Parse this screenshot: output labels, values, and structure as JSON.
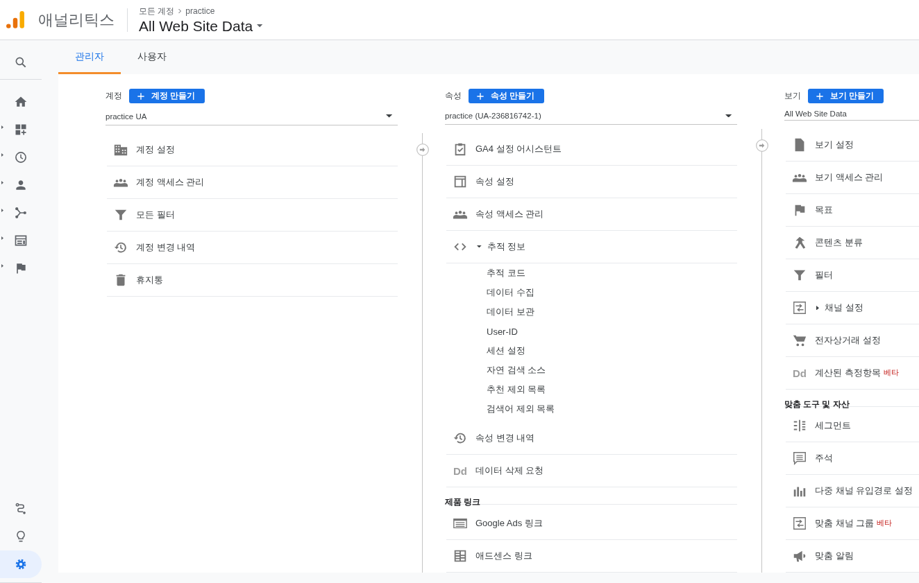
{
  "header": {
    "product": "애널리틱스",
    "breadcrumb": [
      "모든 계정",
      "practice"
    ],
    "title": "All Web Site Data"
  },
  "sidebar": {
    "items": [
      {
        "expandable": false,
        "selected": false
      },
      {
        "expandable": false,
        "selected": false
      },
      {
        "expandable": true,
        "selected": false
      },
      {
        "expandable": true,
        "selected": false
      },
      {
        "expandable": true,
        "selected": false
      },
      {
        "expandable": true,
        "selected": false
      },
      {
        "expandable": true,
        "selected": false
      },
      {
        "expandable": true,
        "selected": false
      },
      {
        "expandable": false,
        "selected": false
      },
      {
        "expandable": false,
        "selected": false
      },
      {
        "expandable": false,
        "selected": true
      }
    ]
  },
  "tabs": [
    {
      "label": "관리자",
      "selected": true
    },
    {
      "label": "사용자",
      "selected": false
    }
  ],
  "columns": [
    {
      "label": "계정",
      "button": "계정 만들기",
      "selector": {
        "value": "practice UA",
        "dropdown": true
      },
      "connector": false,
      "items": [
        {
          "kind": "item",
          "label": "계정 설정"
        },
        {
          "kind": "item",
          "label": "계정 액세스 관리"
        },
        {
          "kind": "item",
          "label": "모든 필터"
        },
        {
          "kind": "item",
          "label": "계정 변경 내역"
        },
        {
          "kind": "item",
          "label": "휴지통"
        }
      ]
    },
    {
      "label": "속성",
      "button": "속성 만들기",
      "selector": {
        "value": "practice (UA-236816742-1)",
        "dropdown": true
      },
      "connector": true,
      "items": [
        {
          "kind": "item",
          "label": "GA4 설정 어시스턴트"
        },
        {
          "kind": "item",
          "label": "속성 설정"
        },
        {
          "kind": "item",
          "label": "속성 액세스 관리"
        },
        {
          "kind": "item",
          "label": "추적 정보",
          "expanded": true,
          "children": [
            {
              "label": "추적 코드"
            },
            {
              "label": "데이터 수집"
            },
            {
              "label": "데이터 보관"
            },
            {
              "label": "User-ID"
            },
            {
              "label": "세션 설정"
            },
            {
              "label": "자연 검색 소스"
            },
            {
              "label": "추천 제외 목록"
            },
            {
              "label": "검색어 제외 목록"
            }
          ]
        },
        {
          "kind": "item",
          "label": "속성 변경 내역"
        },
        {
          "kind": "item",
          "label": "데이터 삭제 요청",
          "icon_text": "Dd"
        },
        {
          "kind": "heading",
          "label": "제품 링크"
        },
        {
          "kind": "item",
          "label": "Google Ads 링크"
        },
        {
          "kind": "item",
          "label": "애드센스 링크"
        }
      ]
    },
    {
      "label": "보기",
      "button": "보기 만들기",
      "selector": {
        "value": "All Web Site Data"
      },
      "connector": true,
      "items": [
        {
          "kind": "item",
          "label": "보기 설정"
        },
        {
          "kind": "item",
          "label": "보기 액세스 관리"
        },
        {
          "kind": "item",
          "label": "목표"
        },
        {
          "kind": "item",
          "label": "콘텐츠 분류"
        },
        {
          "kind": "item",
          "label": "필터"
        },
        {
          "kind": "item",
          "label": "채널 설정",
          "expanded": false
        },
        {
          "kind": "item",
          "label": "전자상거래 설정"
        },
        {
          "kind": "item",
          "label": "계산된 측정항목",
          "icon_text": "Dd",
          "badge": "베타"
        },
        {
          "kind": "heading",
          "label": "맞춤 도구 및 자산"
        },
        {
          "kind": "item",
          "label": "세그먼트"
        },
        {
          "kind": "item",
          "label": "주석"
        },
        {
          "kind": "item",
          "label": "다중 채널 유입경로 설정"
        },
        {
          "kind": "item",
          "label": "맞춤 채널 그룹",
          "badge": "베타"
        },
        {
          "kind": "item",
          "label": "맞춤 알림"
        }
      ]
    }
  ]
}
